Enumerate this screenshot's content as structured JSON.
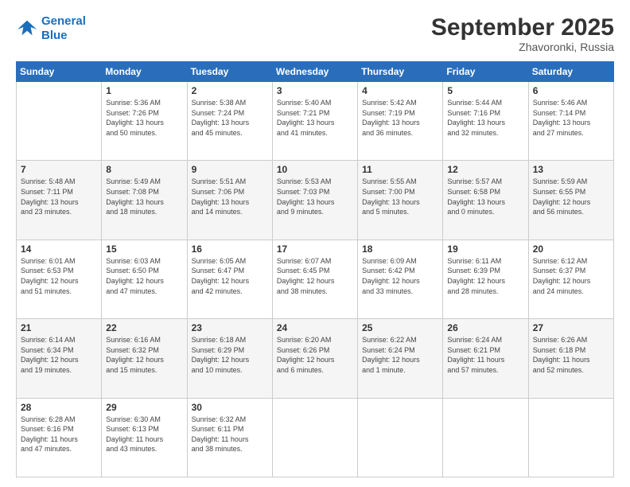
{
  "header": {
    "logo_line1": "General",
    "logo_line2": "Blue",
    "month": "September 2025",
    "location": "Zhavoronki, Russia"
  },
  "weekdays": [
    "Sunday",
    "Monday",
    "Tuesday",
    "Wednesday",
    "Thursday",
    "Friday",
    "Saturday"
  ],
  "weeks": [
    [
      {
        "day": "",
        "info": ""
      },
      {
        "day": "1",
        "info": "Sunrise: 5:36 AM\nSunset: 7:26 PM\nDaylight: 13 hours\nand 50 minutes."
      },
      {
        "day": "2",
        "info": "Sunrise: 5:38 AM\nSunset: 7:24 PM\nDaylight: 13 hours\nand 45 minutes."
      },
      {
        "day": "3",
        "info": "Sunrise: 5:40 AM\nSunset: 7:21 PM\nDaylight: 13 hours\nand 41 minutes."
      },
      {
        "day": "4",
        "info": "Sunrise: 5:42 AM\nSunset: 7:19 PM\nDaylight: 13 hours\nand 36 minutes."
      },
      {
        "day": "5",
        "info": "Sunrise: 5:44 AM\nSunset: 7:16 PM\nDaylight: 13 hours\nand 32 minutes."
      },
      {
        "day": "6",
        "info": "Sunrise: 5:46 AM\nSunset: 7:14 PM\nDaylight: 13 hours\nand 27 minutes."
      }
    ],
    [
      {
        "day": "7",
        "info": "Sunrise: 5:48 AM\nSunset: 7:11 PM\nDaylight: 13 hours\nand 23 minutes."
      },
      {
        "day": "8",
        "info": "Sunrise: 5:49 AM\nSunset: 7:08 PM\nDaylight: 13 hours\nand 18 minutes."
      },
      {
        "day": "9",
        "info": "Sunrise: 5:51 AM\nSunset: 7:06 PM\nDaylight: 13 hours\nand 14 minutes."
      },
      {
        "day": "10",
        "info": "Sunrise: 5:53 AM\nSunset: 7:03 PM\nDaylight: 13 hours\nand 9 minutes."
      },
      {
        "day": "11",
        "info": "Sunrise: 5:55 AM\nSunset: 7:00 PM\nDaylight: 13 hours\nand 5 minutes."
      },
      {
        "day": "12",
        "info": "Sunrise: 5:57 AM\nSunset: 6:58 PM\nDaylight: 13 hours\nand 0 minutes."
      },
      {
        "day": "13",
        "info": "Sunrise: 5:59 AM\nSunset: 6:55 PM\nDaylight: 12 hours\nand 56 minutes."
      }
    ],
    [
      {
        "day": "14",
        "info": "Sunrise: 6:01 AM\nSunset: 6:53 PM\nDaylight: 12 hours\nand 51 minutes."
      },
      {
        "day": "15",
        "info": "Sunrise: 6:03 AM\nSunset: 6:50 PM\nDaylight: 12 hours\nand 47 minutes."
      },
      {
        "day": "16",
        "info": "Sunrise: 6:05 AM\nSunset: 6:47 PM\nDaylight: 12 hours\nand 42 minutes."
      },
      {
        "day": "17",
        "info": "Sunrise: 6:07 AM\nSunset: 6:45 PM\nDaylight: 12 hours\nand 38 minutes."
      },
      {
        "day": "18",
        "info": "Sunrise: 6:09 AM\nSunset: 6:42 PM\nDaylight: 12 hours\nand 33 minutes."
      },
      {
        "day": "19",
        "info": "Sunrise: 6:11 AM\nSunset: 6:39 PM\nDaylight: 12 hours\nand 28 minutes."
      },
      {
        "day": "20",
        "info": "Sunrise: 6:12 AM\nSunset: 6:37 PM\nDaylight: 12 hours\nand 24 minutes."
      }
    ],
    [
      {
        "day": "21",
        "info": "Sunrise: 6:14 AM\nSunset: 6:34 PM\nDaylight: 12 hours\nand 19 minutes."
      },
      {
        "day": "22",
        "info": "Sunrise: 6:16 AM\nSunset: 6:32 PM\nDaylight: 12 hours\nand 15 minutes."
      },
      {
        "day": "23",
        "info": "Sunrise: 6:18 AM\nSunset: 6:29 PM\nDaylight: 12 hours\nand 10 minutes."
      },
      {
        "day": "24",
        "info": "Sunrise: 6:20 AM\nSunset: 6:26 PM\nDaylight: 12 hours\nand 6 minutes."
      },
      {
        "day": "25",
        "info": "Sunrise: 6:22 AM\nSunset: 6:24 PM\nDaylight: 12 hours\nand 1 minute."
      },
      {
        "day": "26",
        "info": "Sunrise: 6:24 AM\nSunset: 6:21 PM\nDaylight: 11 hours\nand 57 minutes."
      },
      {
        "day": "27",
        "info": "Sunrise: 6:26 AM\nSunset: 6:18 PM\nDaylight: 11 hours\nand 52 minutes."
      }
    ],
    [
      {
        "day": "28",
        "info": "Sunrise: 6:28 AM\nSunset: 6:16 PM\nDaylight: 11 hours\nand 47 minutes."
      },
      {
        "day": "29",
        "info": "Sunrise: 6:30 AM\nSunset: 6:13 PM\nDaylight: 11 hours\nand 43 minutes."
      },
      {
        "day": "30",
        "info": "Sunrise: 6:32 AM\nSunset: 6:11 PM\nDaylight: 11 hours\nand 38 minutes."
      },
      {
        "day": "",
        "info": ""
      },
      {
        "day": "",
        "info": ""
      },
      {
        "day": "",
        "info": ""
      },
      {
        "day": "",
        "info": ""
      }
    ]
  ]
}
